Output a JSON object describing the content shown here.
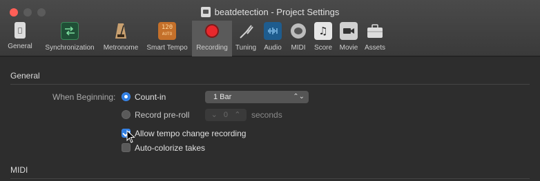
{
  "window": {
    "title": "beatdetection - Project Settings",
    "traffic_lights": [
      "close",
      "minimize",
      "zoom"
    ]
  },
  "toolbar": {
    "items": [
      {
        "label": "General",
        "icon": "general-switch-icon"
      },
      {
        "label": "Synchronization",
        "icon": "sync-arrows-icon"
      },
      {
        "label": "Metronome",
        "icon": "metronome-icon"
      },
      {
        "label": "Smart Tempo",
        "icon": "smart-tempo-icon",
        "icon_text_top": "120",
        "icon_text_bottom": "AUTO"
      },
      {
        "label": "Recording",
        "icon": "record-icon",
        "selected": true
      },
      {
        "label": "Tuning",
        "icon": "tuning-fork-icon"
      },
      {
        "label": "Audio",
        "icon": "audio-waveform-icon"
      },
      {
        "label": "MIDI",
        "icon": "midi-icon"
      },
      {
        "label": "Score",
        "icon": "score-icon"
      },
      {
        "label": "Movie",
        "icon": "movie-camera-icon"
      },
      {
        "label": "Assets",
        "icon": "assets-briefcase-icon"
      }
    ]
  },
  "general": {
    "heading": "General",
    "when_beginning_label": "When Beginning:",
    "count_in": {
      "label": "Count-in",
      "selected": true,
      "value": "1 Bar"
    },
    "record_preroll": {
      "label": "Record pre-roll",
      "selected": false,
      "value": "0",
      "unit": "seconds"
    },
    "allow_tempo_change": {
      "label": "Allow tempo change recording",
      "checked": true
    },
    "auto_colorize": {
      "label": "Auto-colorize takes",
      "checked": false
    }
  },
  "midi": {
    "heading": "MIDI"
  },
  "colors": {
    "accent": "#2f7de0",
    "record_red": "#e8282c",
    "close_red": "#ff5f57"
  }
}
